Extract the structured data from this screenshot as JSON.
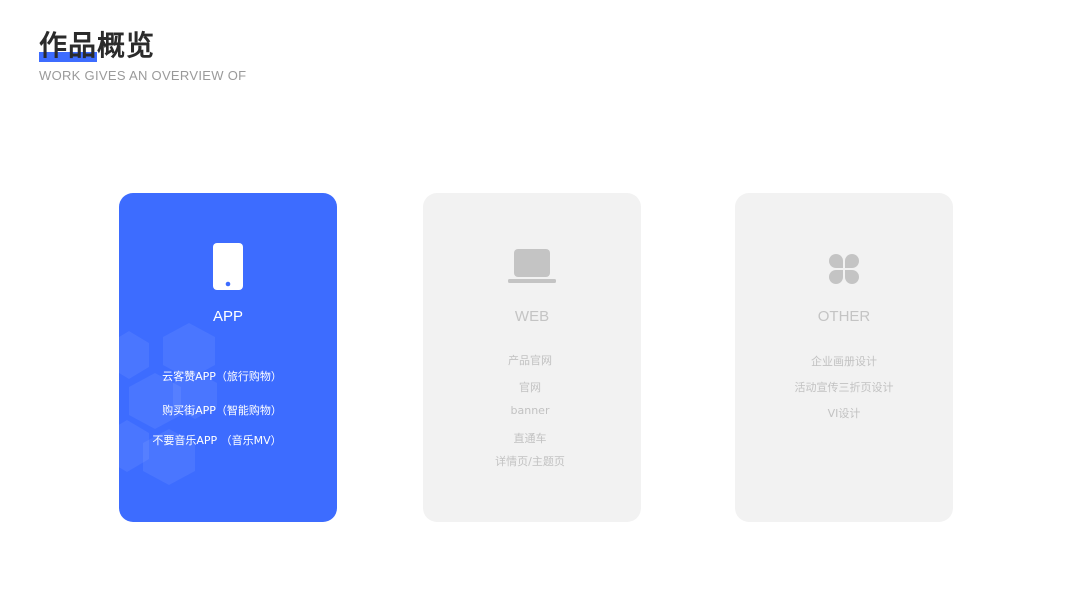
{
  "header": {
    "title": "作品概览",
    "subtitle": "WORK GIVES AN OVERVIEW OF"
  },
  "cards": [
    {
      "title": "APP",
      "icon": "phone-icon",
      "items": [
        "云客赞APP（旅行购物）",
        "购买街APP（智能购物）",
        "不要音乐APP （音乐MV）"
      ]
    },
    {
      "title": "WEB",
      "icon": "laptop-icon",
      "items": [
        "产品官网",
        "官网",
        "banner",
        "直通车",
        "详情页/主题页"
      ]
    },
    {
      "title": "OTHER",
      "icon": "clover-icon",
      "items": [
        "企业画册设计",
        "活动宣传三折页设计",
        "VI设计"
      ]
    }
  ],
  "colors": {
    "accent": "#3d6cff",
    "card_inactive": "#f2f2f2",
    "text_inactive": "#c2c2c2"
  }
}
